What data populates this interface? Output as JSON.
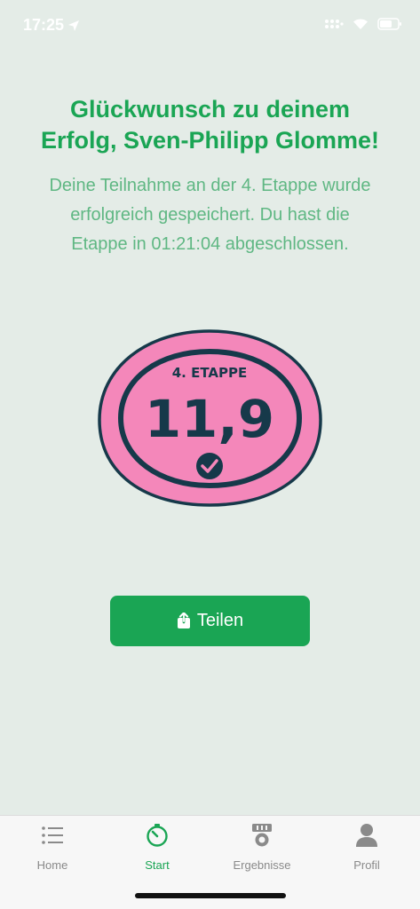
{
  "status": {
    "time": "17:25"
  },
  "headline": [
    "Glückwunsch zu deinem",
    "Erfolg, Sven-Philipp Glomme!"
  ],
  "message": [
    "Deine Teilnahme an der 4. Etappe wurde",
    "erfolgreich gespeichert. Du hast die",
    "Etappe in 01:21:04 abgeschlossen."
  ],
  "badge": {
    "stage": "4. ETAPPE",
    "distance": "11,9",
    "icon": "checkmark-icon"
  },
  "share_button": {
    "label": "Teilen",
    "icon": "share-icon"
  },
  "tabs": [
    {
      "label": "Home",
      "icon": "list-icon",
      "active": false
    },
    {
      "label": "Start",
      "icon": "stopwatch-icon",
      "active": true
    },
    {
      "label": "Ergebnisse",
      "icon": "medal-icon",
      "active": false
    },
    {
      "label": "Profil",
      "icon": "person-icon",
      "active": false
    }
  ],
  "colors": {
    "background": "#e4ece7",
    "accent": "#1aa554",
    "message_text": "#5fb783",
    "badge_pink": "#f487ba",
    "badge_dark": "#16394a"
  }
}
